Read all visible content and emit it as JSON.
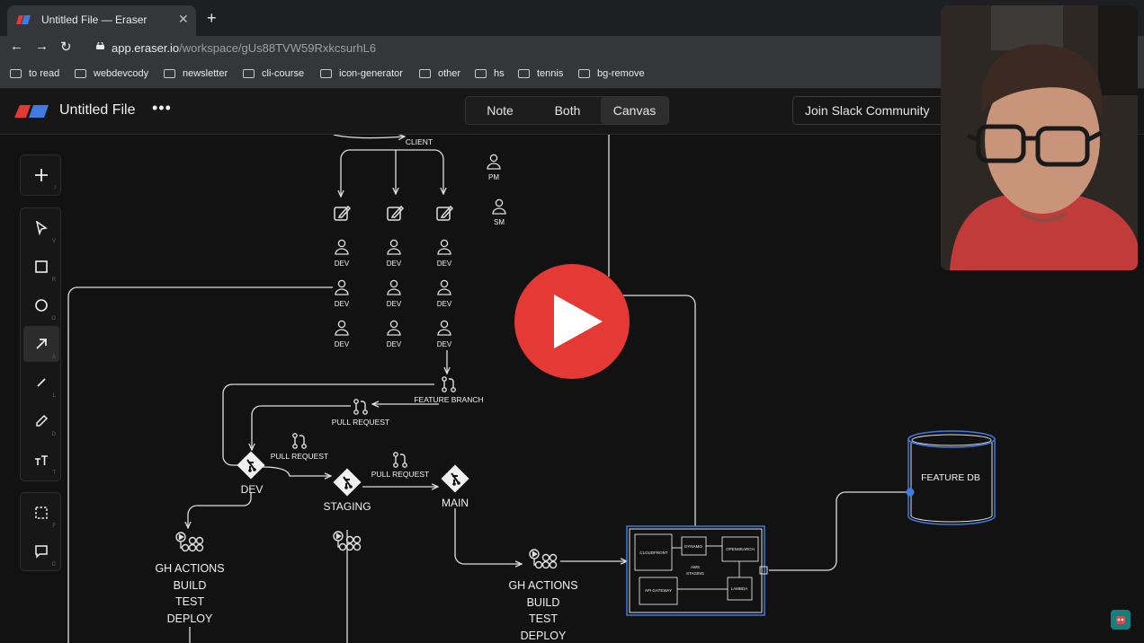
{
  "browser": {
    "tab_title": "Untitled File — Eraser",
    "tab_close": "✕",
    "new_tab": "+",
    "url_domain": "app.eraser.io",
    "url_path": "/workspace/gUs88TVW59RxkcsurhL6",
    "back_icon": "arrow-left",
    "forward_icon": "arrow-right",
    "reload_icon": "reload"
  },
  "bookmarks": [
    "to read",
    "webdevcody",
    "newsletter",
    "cli-course",
    "icon-generator",
    "other",
    "hs",
    "tennis",
    "bg-remove"
  ],
  "app": {
    "file_title": "Untitled File",
    "more": "•••",
    "modes": [
      "Note",
      "Both",
      "Canvas"
    ],
    "active_mode": "Canvas",
    "slack_button": "Join Slack Community"
  },
  "tools": {
    "add": {
      "icon": "plus-icon",
      "key": "/"
    },
    "items": [
      {
        "icon": "pointer-icon",
        "key": "V"
      },
      {
        "icon": "rectangle-icon",
        "key": "R"
      },
      {
        "icon": "circle-icon",
        "key": "O"
      },
      {
        "icon": "arrow-icon",
        "key": "A"
      },
      {
        "icon": "line-icon",
        "key": "L"
      },
      {
        "icon": "pencil-icon",
        "key": "D"
      },
      {
        "icon": "text-icon",
        "key": "T"
      }
    ],
    "extra": [
      {
        "icon": "frame-icon",
        "key": "F"
      },
      {
        "icon": "comment-icon",
        "key": "C"
      }
    ],
    "active_tool": "arrow-icon"
  },
  "diagram": {
    "client": "CLIENT",
    "pm": "PM",
    "sm": "SM",
    "dev": "DEV",
    "feature_branch": "FEATURE BRANCH",
    "pull_request": "PULL REQUEST",
    "dev_branch": "DEV",
    "staging_branch": "STAGING",
    "main_branch": "MAIN",
    "gh_actions": [
      "GH ACTIONS",
      "BUILD",
      "TEST",
      "DEPLOY"
    ],
    "feature_db": "FEATURE DB",
    "aws": {
      "cloudfront": "CLOUDFRONT",
      "dynamo": "DYNAMO",
      "opensearch": "OPENSEARCH",
      "aws": "AWS",
      "staging": "STAGING",
      "api_gateway": "API GATEWAY",
      "lambda": "LAMBDA"
    }
  },
  "colors": {
    "play_button": "#e53935",
    "accent_blue": "#3f7be0",
    "canvas_bg": "#121212"
  }
}
